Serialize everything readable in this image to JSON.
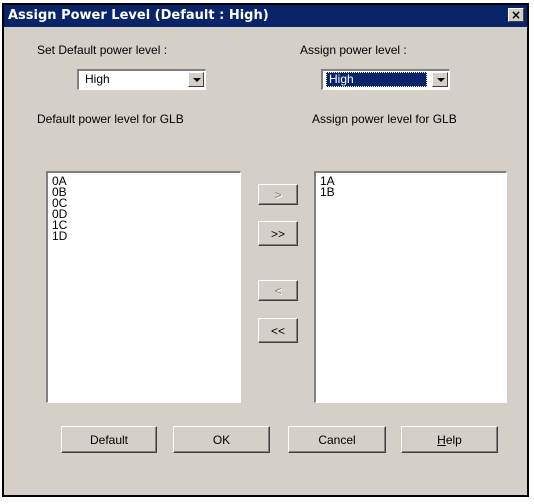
{
  "window": {
    "title": "Assign Power Level (Default : High)",
    "close_label": "×"
  },
  "left": {
    "default_label": "Set Default power level :",
    "default_value": "High",
    "list_label": "Default power level for GLB",
    "items": [
      "0A",
      "0B",
      "0C",
      "0D",
      "1C",
      "1D"
    ]
  },
  "right": {
    "assign_label": "Assign power level :",
    "assign_value": "High",
    "list_label": "Assign power level for GLB",
    "items": [
      "1A",
      "1B"
    ]
  },
  "transfer": {
    "move_right": ">",
    "move_all_right": ">>",
    "move_left": "<",
    "move_all_left": "<<"
  },
  "buttons": {
    "default": "Default",
    "ok": "OK",
    "cancel": "Cancel",
    "help_prefix": "",
    "help_mnemonic": "H",
    "help_rest": "elp"
  }
}
